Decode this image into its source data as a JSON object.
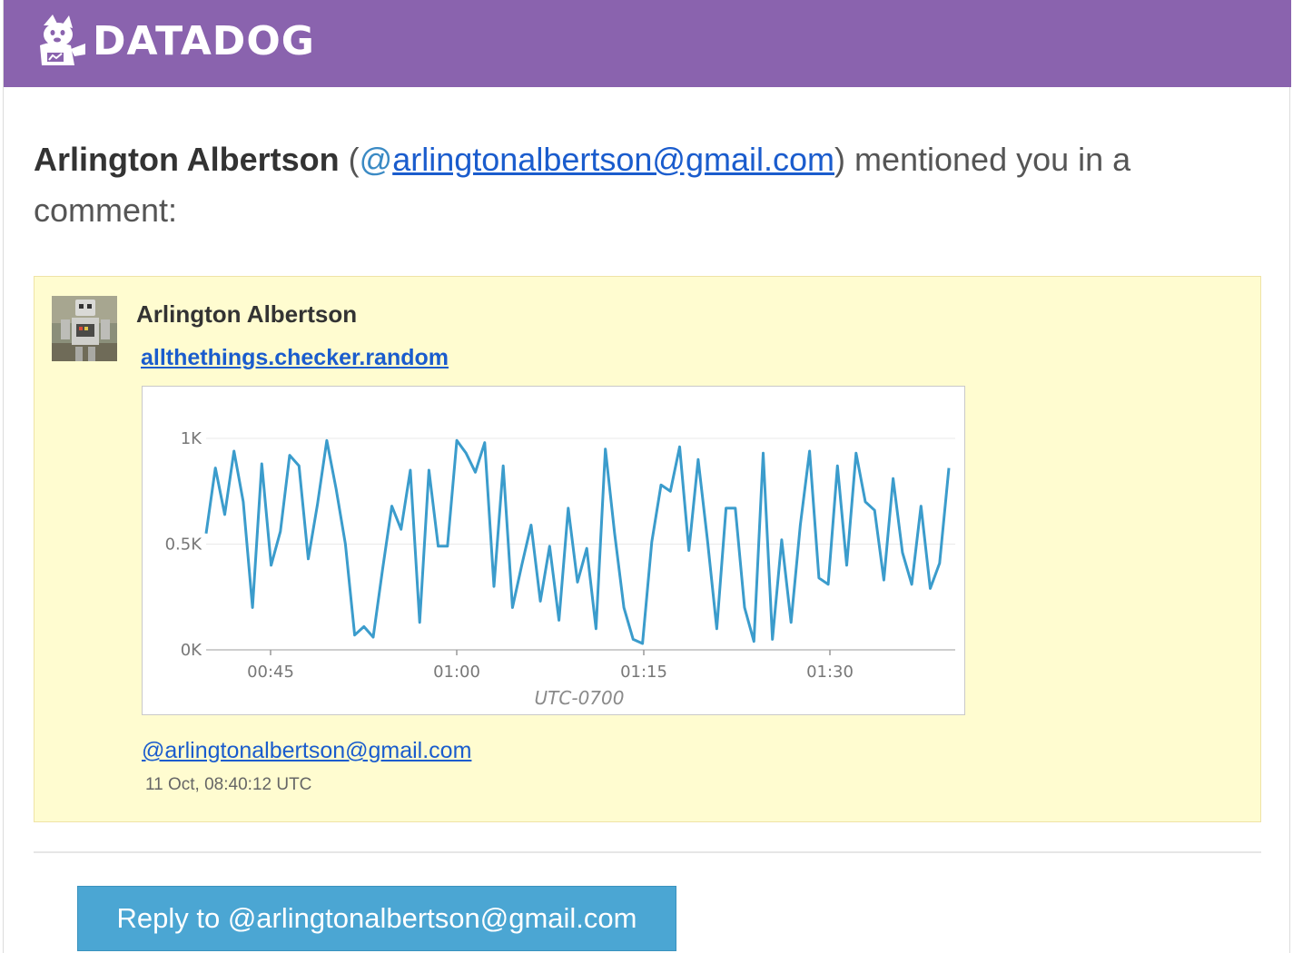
{
  "brand": {
    "name": "DATADOG",
    "header_color": "#8a63ae"
  },
  "intro": {
    "author": "Arlington Albertson",
    "open_paren": "(",
    "at_symbol": "@",
    "email": "arlingtonalbertson@gmail.com",
    "rest": ") mentioned you in a comment:"
  },
  "comment": {
    "author": "Arlington Albertson",
    "metric": "allthethings.checker.random",
    "mention": "@arlingtonalbertson@gmail.com",
    "timestamp": "11 Oct, 08:40:12 UTC",
    "box_color": "#fffcd0"
  },
  "chart_data": {
    "type": "line",
    "title": "",
    "xlabel": "UTC-0700",
    "ylabel": "",
    "ylim": [
      0,
      1000
    ],
    "yticks": [
      "0K",
      "0.5K",
      "1K"
    ],
    "xticks": [
      "00:45",
      "01:00",
      "01:15",
      "01:30"
    ],
    "line_color": "#3b9ccc",
    "series": [
      {
        "values": [
          550,
          860,
          640,
          940,
          700,
          200,
          880,
          400,
          560,
          920,
          870,
          430,
          690,
          990,
          760,
          500,
          70,
          110,
          60,
          380,
          680,
          570,
          850,
          130,
          850,
          490,
          490,
          990,
          930,
          840,
          980,
          300,
          870,
          200,
          400,
          590,
          230,
          490,
          140,
          670,
          320,
          480,
          100,
          950,
          550,
          200,
          50,
          30,
          510,
          780,
          750,
          960,
          470,
          900,
          520,
          100,
          670,
          670,
          200,
          40,
          930,
          50,
          520,
          130,
          590,
          940,
          340,
          310,
          870,
          400,
          930,
          700,
          660,
          330,
          810,
          460,
          310,
          680,
          290,
          410,
          860
        ]
      }
    ]
  },
  "reply_button": {
    "label": "Reply to @arlingtonalbertson@gmail.com",
    "color": "#4ba6d3"
  }
}
